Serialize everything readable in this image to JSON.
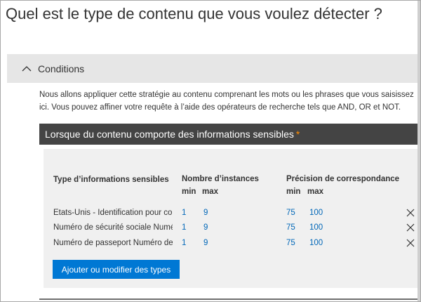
{
  "page": {
    "title": "Quel est le type de contenu que vous voulez détecter ?"
  },
  "conditions": {
    "label": "Conditions",
    "description": "Nous allons appliquer cette stratégie au contenu comprenant les mots ou les phrases que vous saisissez ici. Vous pouvez affiner votre requête à l’aide des opérateurs de recherche tels que AND, OR et NOT."
  },
  "section": {
    "title": "Lorsque du contenu comporte des informations sensibles",
    "required_mark": "*",
    "required_color": "#ff8c00"
  },
  "table": {
    "headers": {
      "type": "Type d’informations sensibles",
      "instances": "Nombre d’instances",
      "accuracy": "Précision de correspondance",
      "min": "min",
      "max": "max"
    },
    "rows": [
      {
        "name": "États-Unis - Identification pour contribuables",
        "inst_min": "1",
        "inst_max": "9",
        "acc_min": "75",
        "acc_max": "100"
      },
      {
        "name": "Numéro de sécurité sociale Numéro",
        "inst_min": "1",
        "inst_max": "9",
        "acc_min": "75",
        "acc_max": "100"
      },
      {
        "name": "Numéro de passeport Numéro de",
        "inst_min": "1",
        "inst_max": "9",
        "acc_min": "75",
        "acc_max": "100"
      }
    ],
    "delete_icon": "close-icon"
  },
  "actions": {
    "add_label": "Ajouter ou modifier des types"
  },
  "colors": {
    "accent": "#0078d4",
    "link": "#0067b8",
    "section_bar": "#444444",
    "header_bg": "#e6e6e6",
    "panel_bg": "#f0f0f0"
  }
}
